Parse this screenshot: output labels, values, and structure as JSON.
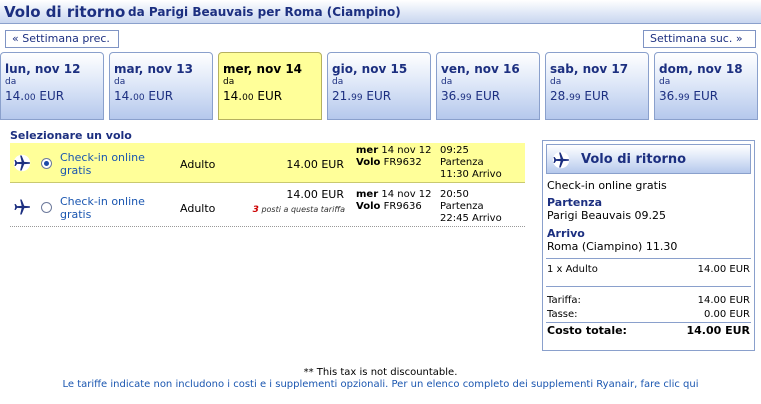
{
  "header": {
    "title": "Volo di ritorno",
    "route": "da Parigi Beauvais per Roma (Ciampino)"
  },
  "week_nav": {
    "prev": "« Settimana prec.",
    "next": "Settimana suc. »"
  },
  "days": [
    {
      "name": "lun, nov 12",
      "from": "da",
      "price_int": "14.",
      "price_dec": "00",
      "currency": "EUR",
      "selected": false
    },
    {
      "name": "mar, nov 13",
      "from": "da",
      "price_int": "14.",
      "price_dec": "00",
      "currency": "EUR",
      "selected": false
    },
    {
      "name": "mer, nov 14",
      "from": "da",
      "price_int": "14.",
      "price_dec": "00",
      "currency": "EUR",
      "selected": true
    },
    {
      "name": "gio, nov 15",
      "from": "da",
      "price_int": "21.",
      "price_dec": "99",
      "currency": "EUR",
      "selected": false
    },
    {
      "name": "ven, nov 16",
      "from": "da",
      "price_int": "36.",
      "price_dec": "99",
      "currency": "EUR",
      "selected": false
    },
    {
      "name": "sab, nov 17",
      "from": "da",
      "price_int": "28.",
      "price_dec": "99",
      "currency": "EUR",
      "selected": false
    },
    {
      "name": "dom, nov 18",
      "from": "da",
      "price_int": "36.",
      "price_dec": "99",
      "currency": "EUR",
      "selected": false
    }
  ],
  "flights": {
    "title": "Selezionare un volo",
    "rows": [
      {
        "checkin": "Check-in online gratis",
        "passenger": "Adulto",
        "price": "14.00 EUR",
        "seats_num": "",
        "seats_text": "",
        "day": "mer",
        "date": "14 nov 12",
        "flight_label": "Volo",
        "flight_no": "FR9632",
        "dep_time": "09:25",
        "dep_label": "Partenza",
        "arr_time": "11:30",
        "arr_label": "Arrivo",
        "selected": true
      },
      {
        "checkin": "Check-in online gratis",
        "passenger": "Adulto",
        "price": "14.00 EUR",
        "seats_num": "3",
        "seats_text": "posti a questa tariffa",
        "day": "mer",
        "date": "14 nov 12",
        "flight_label": "Volo",
        "flight_no": "FR9636",
        "dep_time": "20:50",
        "dep_label": "Partenza",
        "arr_time": "22:45",
        "arr_label": "Arrivo",
        "selected": false
      }
    ]
  },
  "summary": {
    "title": "Volo di ritorno",
    "checkin": "Check-in online gratis",
    "dep_label": "Partenza",
    "dep_value": "Parigi Beauvais 09.25",
    "arr_label": "Arrivo",
    "arr_value": "Roma (Ciampino) 11.30",
    "pax_label": "1 x Adulto",
    "pax_value": "14.00 EUR",
    "fare_label": "Tariffa:",
    "fare_value": "14.00 EUR",
    "tax_label": "Tasse:",
    "tax_value": "0.00 EUR",
    "total_label": "Costo totale:",
    "total_value": "14.00 EUR"
  },
  "footer": {
    "note1": "** This tax is not discountable.",
    "note2": "Le tariffe indicate non includono i costi e i supplementi opzionali. Per un elenco completo dei supplementi Ryanair, fare clic qui"
  },
  "icons": {
    "plane": "plane-icon",
    "radio": "radio-icon"
  },
  "colors": {
    "accent": "#1c2f80",
    "link": "#1a56b0",
    "selected_bg": "#ffff99",
    "seats_highlight": "#cc0000"
  }
}
